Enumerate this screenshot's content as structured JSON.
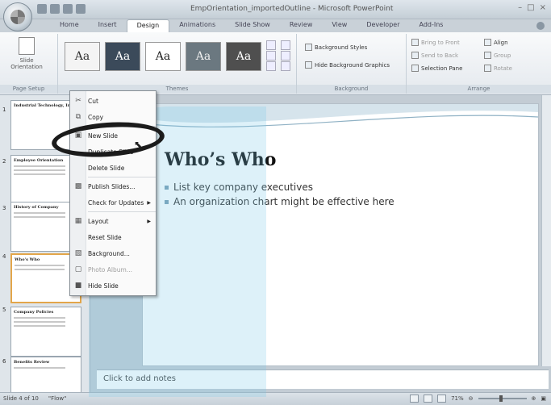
{
  "window": {
    "title": "EmpOrientation_importedOutline - Microsoft PowerPoint"
  },
  "tabs": [
    "Home",
    "Insert",
    "Design",
    "Animations",
    "Slide Show",
    "Review",
    "View",
    "Developer",
    "Add-Ins"
  ],
  "active_tab": "Design",
  "ribbon": {
    "page_setup": {
      "label": "Page Setup",
      "slide_orientation": "Slide Orientation"
    },
    "themes": {
      "label": "Themes",
      "samples": [
        "Aa",
        "Aa",
        "Aa",
        "Aa",
        "Aa"
      ]
    },
    "background": {
      "label": "Background",
      "background_styles": "Background Styles",
      "hide_graphics": "Hide Background Graphics"
    },
    "arrange": {
      "label": "Arrange",
      "bring_to_front": "Bring to Front",
      "send_to_back": "Send to Back",
      "selection_pane": "Selection Pane",
      "align": "Align",
      "group": "Group",
      "rotate": "Rotate"
    }
  },
  "thumbnails": [
    {
      "num": "1",
      "title": "Industrial Technology, Inc"
    },
    {
      "num": "2",
      "title": "Employee Orientation"
    },
    {
      "num": "3",
      "title": "History of Company"
    },
    {
      "num": "4",
      "title": "Who's Who"
    },
    {
      "num": "5",
      "title": "Company Policies"
    },
    {
      "num": "6",
      "title": "Benefits Review"
    }
  ],
  "context_menu": {
    "items": [
      {
        "label": "Cut",
        "icon": "scissors-icon",
        "disabled": false
      },
      {
        "label": "Copy",
        "icon": "copy-icon",
        "disabled": false
      },
      {
        "label": "New Slide",
        "icon": "new-slide-icon",
        "disabled": false
      },
      {
        "label": "Duplicate Slide",
        "icon": "",
        "disabled": false
      },
      {
        "label": "Delete Slide",
        "icon": "",
        "disabled": false
      },
      {
        "label": "Publish Slides...",
        "icon": "publish-icon",
        "disabled": false
      },
      {
        "label": "Check for Updates",
        "icon": "",
        "disabled": false,
        "submenu": true
      },
      {
        "label": "Layout",
        "icon": "layout-icon",
        "disabled": false,
        "submenu": true
      },
      {
        "label": "Reset Slide",
        "icon": "",
        "disabled": false
      },
      {
        "label": "Background...",
        "icon": "background-icon",
        "disabled": false
      },
      {
        "label": "Photo Album...",
        "icon": "photo-icon",
        "disabled": true
      },
      {
        "label": "Hide Slide",
        "icon": "hide-slide-icon",
        "disabled": false
      }
    ]
  },
  "slide": {
    "title": "Who’s Who",
    "bullets": [
      "List key company executives",
      "An organization chart might be effective here"
    ]
  },
  "notes": {
    "placeholder": "Click to add notes"
  },
  "status": {
    "slide_info": "Slide 4 of 10",
    "theme": "\"Flow\"",
    "zoom": "71%"
  }
}
